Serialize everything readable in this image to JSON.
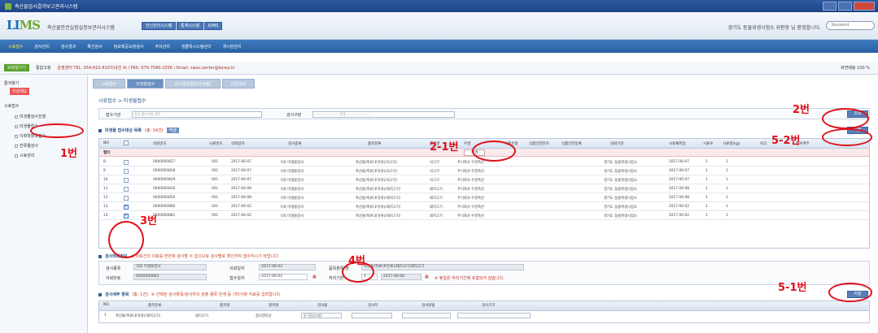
{
  "window": {
    "title": "축산물검사결과보고관리시스템"
  },
  "header": {
    "logo_main": "LI",
    "logo_accent": "MS",
    "app_title": "축산물안전실험실정보관리시스템",
    "buttons": [
      "전산관리시스템",
      "통계시스템",
      "KIMS"
    ],
    "user_info": "경기도 동물위생시험소 위판장 님 환영합니다.",
    "search_placeholder": "Keyword"
  },
  "menu": [
    "시료접수",
    "검사관리",
    "검사결과",
    "확인검사",
    "정보제공요청검사",
    "주의관리",
    "생물학시스템관리",
    "게시판관리"
  ],
  "infobar": {
    "green_button": "모바일가기",
    "checkbox_label": "통합고정",
    "notice": "운영센터 TEL: 054-810-8107(내선 4) / FAX: 070-7580-2056 / Email: swss.center@korea.kr",
    "zoom_label": "화면배율",
    "zoom_value": "100 %"
  },
  "sidebar": {
    "top": "즐겨찾기",
    "badge": "지원제도",
    "group": "시료접수",
    "items": [
      "미생물검사진행",
      "미생물접수",
      "이화학항목접수",
      "잔류물검사",
      "시료관리"
    ]
  },
  "tabs": [
    "시료접수",
    "미생물접수",
    "검사결과입력(미생물)",
    "잔류조회"
  ],
  "breadcrumb": "시료접수 > 미생물접수",
  "searchpanel": {
    "label_period": "접수기관",
    "period_placeholder": "검사 접수기관 선택",
    "label_type": "검사구분",
    "type_value": "-------------------- 전체 --------------------",
    "search_button": "조회"
  },
  "list_section": {
    "title": "미생물 접수대상 목록",
    "count": "(총: 14건)",
    "mini_btn": "엑셀",
    "save_button": "저장"
  },
  "grid": {
    "headers": [
      "NO",
      "",
      "의뢰번호",
      "시료번호",
      "의뢰일자",
      "검사종류",
      "품목분류",
      "품목명",
      "우권",
      "식품유형",
      "식품안전번호",
      "식품안전등록",
      "의뢰기관",
      "시료채취일",
      "시료수",
      "시료량(kg)",
      "비고",
      "접수여부"
    ],
    "filter_label": "필터",
    "filter_value": "우권",
    "rows": [
      {
        "no": "8",
        "req": "0000000827",
        "sno": "001",
        "date": "2017-06-07",
        "kind": "식육 미생물검사",
        "cat": "축산물/축류(포유류)/쇠고기/",
        "item": "쇠고기",
        "farm": "주식회사 우경축산",
        "org": "경기도 동물위생시험소",
        "sdate": "2017-06-07",
        "cnt": "1",
        "amt": "1",
        "checked": false
      },
      {
        "no": "9",
        "req": "0000000828",
        "sno": "001",
        "date": "2017-06-07",
        "kind": "식육 미생물검사",
        "cat": "축산물/축류(포유류)/쇠고기/",
        "item": "쇠고기",
        "farm": "주식회사 우경축산",
        "org": "경기도 동물위생시험소",
        "sdate": "2017-06-07",
        "cnt": "1",
        "amt": "1",
        "checked": false
      },
      {
        "no": "10",
        "req": "0000000829",
        "sno": "001",
        "date": "2017-06-07",
        "kind": "식육 미생물검사",
        "cat": "축산물/축류(포유류)/쇠고기/",
        "item": "쇠고기",
        "farm": "주식회사 우경축산",
        "org": "경기도 동물위생시험소",
        "sdate": "2017-06-07",
        "cnt": "1",
        "amt": "1",
        "checked": false
      },
      {
        "no": "11",
        "req": "0000000830",
        "sno": "001",
        "date": "2017-06-08",
        "kind": "식육 미생물검사",
        "cat": "축산물/축류(포유류)/돼지고기/",
        "item": "돼지고기",
        "farm": "주식회사 우경축산",
        "org": "경기도 동물위생시험소",
        "sdate": "2017-06-08",
        "cnt": "1",
        "amt": "1",
        "checked": false
      },
      {
        "no": "12",
        "req": "0000000850",
        "sno": "001",
        "date": "2017-06-08",
        "kind": "식육 미생물검사",
        "cat": "축산물/축류(포유류)/돼지고기/",
        "item": "돼지고기",
        "farm": "주식회사 우경축산",
        "org": "경기도 동물위생시험소",
        "sdate": "2017-06-08",
        "cnt": "1",
        "amt": "1",
        "checked": false
      },
      {
        "no": "13",
        "req": "0000000880",
        "sno": "001",
        "date": "2017-06-02",
        "kind": "식육 미생물검사",
        "cat": "축산물/축류(포유류)/돼지고기/",
        "item": "돼지고기",
        "farm": "주식회사 우경축산",
        "org": "경기도 동물위생시험소",
        "sdate": "2017-06-02",
        "cnt": "1",
        "amt": "1",
        "checked": true
      },
      {
        "no": "14",
        "req": "0000000881",
        "sno": "001",
        "date": "2017-06-02",
        "kind": "식육 미생물검사",
        "cat": "축산물/축류(포유류)/돼지고기/",
        "item": "돼지고기",
        "farm": "주식회사 우경축산",
        "org": "경기도 동물위생시험소",
        "sdate": "2017-06-02",
        "cnt": "1",
        "amt": "1",
        "checked": true
      }
    ]
  },
  "detail": {
    "title": "검사의뢰정보",
    "note": "※ 의뢰건의 의뢰를 한번에 검사할 수 없으므로 검사별로 확인하여 접수하시기 바랍니다.",
    "l_kind": "검사종류",
    "v_kind": "식육 미생물검사",
    "l_req": "의뢰번호",
    "v_req": "0000000881",
    "l_rdate": "의뢰일자",
    "v_rdate": "2017-06-02",
    "l_adate": "접수일자",
    "v_adate": "2017-06-02",
    "l_cat": "품목분류/명",
    "v_cat": "축산물/축류(포유류)/돼지고기/돼지고기",
    "l_period": "처리기한",
    "v_period": "4",
    "v_period_date": "2017-06-06",
    "note2": "※ 휴일은 처리기간에 포함되지 않습니다."
  },
  "sub_section": {
    "title": "검사세부 항목",
    "count": "(총: 1건)",
    "note": "※ 선택된 검사항목/검사자의 검출 종류 한계 등 기타사항 자료를 입력합니다.",
    "save_button": "저장",
    "headers": [
      "NO",
      "품목분류",
      "품목명",
      "항목명",
      "검사법",
      "검사자",
      "검사방법",
      "검사기기"
    ],
    "row": {
      "no": "1",
      "cat": "축산물/축류(포유류)/돼지고기/",
      "item": "돼지고기",
      "test": "살모넬라균",
      "method": "유 (정성시험)"
    }
  },
  "annotations": [
    "1번",
    "2번",
    "2-1번",
    "3번",
    "4번",
    "5-1번",
    "5-2번"
  ]
}
